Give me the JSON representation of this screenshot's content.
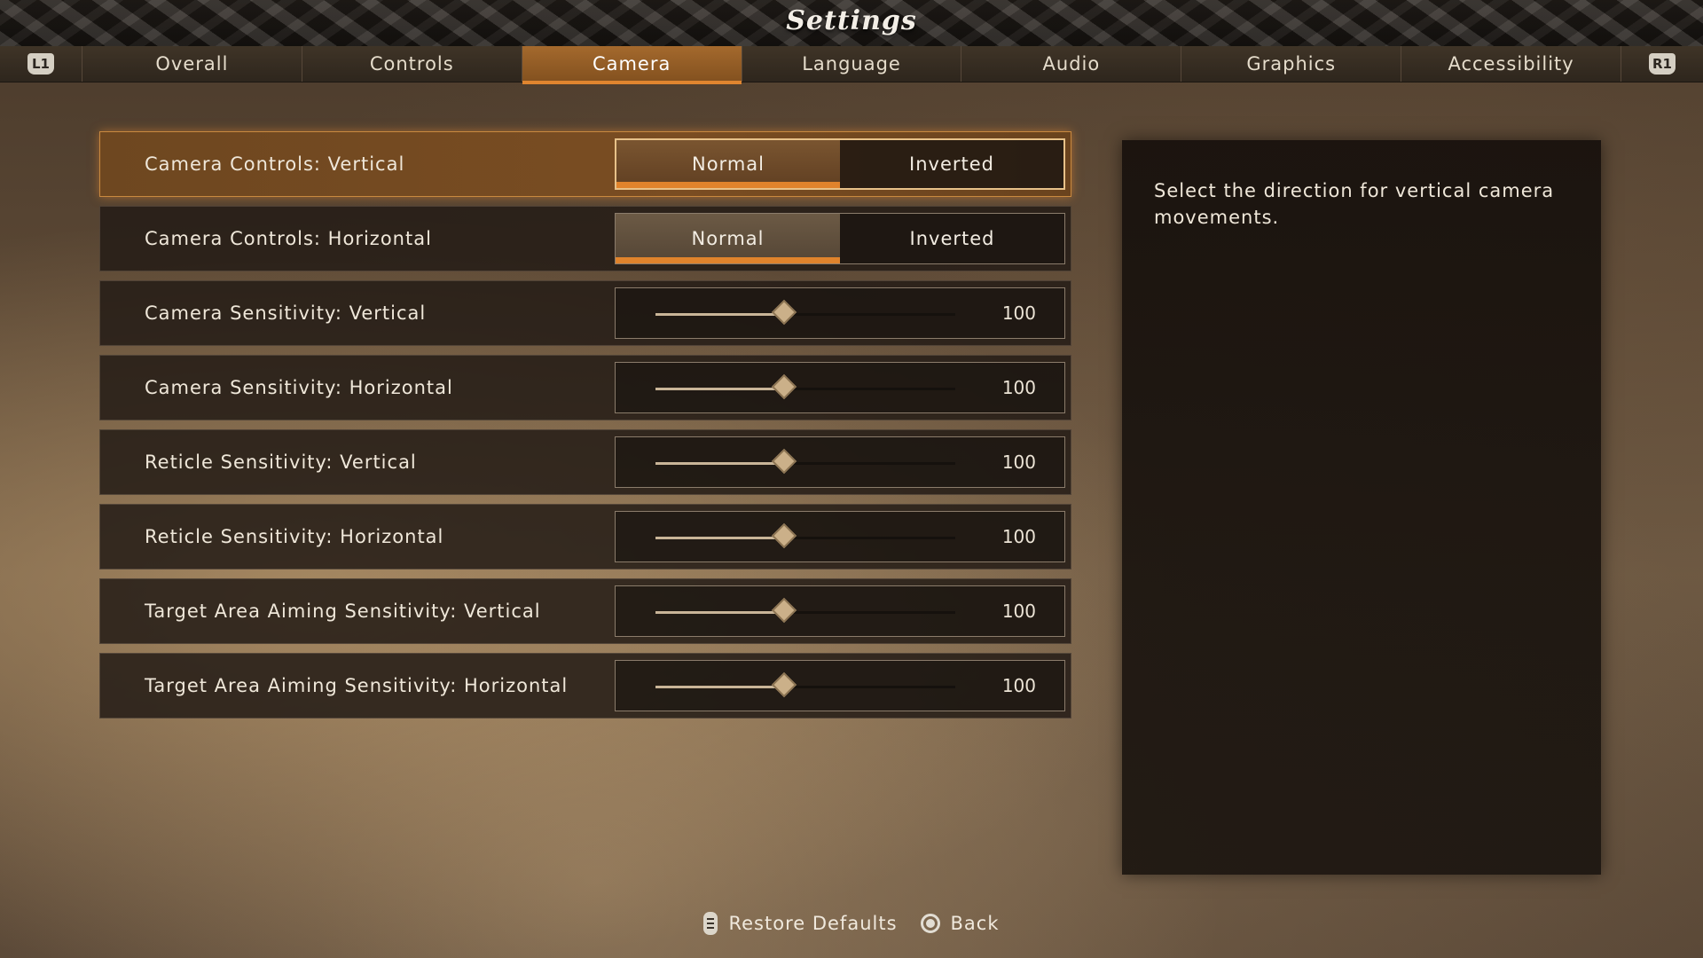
{
  "title": "Settings",
  "nav": {
    "left_button": "L1",
    "right_button": "R1",
    "tabs": [
      {
        "label": "Overall",
        "active": false
      },
      {
        "label": "Controls",
        "active": false
      },
      {
        "label": "Camera",
        "active": true
      },
      {
        "label": "Language",
        "active": false
      },
      {
        "label": "Audio",
        "active": false
      },
      {
        "label": "Graphics",
        "active": false
      },
      {
        "label": "Accessibility",
        "active": false
      }
    ]
  },
  "settings": {
    "camera_vertical": {
      "label": "Camera Controls: Vertical",
      "options": [
        "Normal",
        "Inverted"
      ],
      "selected": "Normal"
    },
    "camera_horizontal": {
      "label": "Camera Controls: Horizontal",
      "options": [
        "Normal",
        "Inverted"
      ],
      "selected": "Normal"
    },
    "sliders": [
      {
        "label": "Camera Sensitivity: Vertical",
        "value": "100",
        "fraction": 0.43
      },
      {
        "label": "Camera Sensitivity: Horizontal",
        "value": "100",
        "fraction": 0.43
      },
      {
        "label": "Reticle Sensitivity: Vertical",
        "value": "100",
        "fraction": 0.43
      },
      {
        "label": "Reticle Sensitivity: Horizontal",
        "value": "100",
        "fraction": 0.43
      },
      {
        "label": "Target Area Aiming Sensitivity: Vertical",
        "value": "100",
        "fraction": 0.43
      },
      {
        "label": "Target Area Aiming Sensitivity: Horizontal",
        "value": "100",
        "fraction": 0.43
      }
    ]
  },
  "description": "Select the direction for vertical camera movements.",
  "footer": {
    "restore_label": "Restore Defaults",
    "back_label": "Back"
  },
  "colors": {
    "accent": "#e0832c",
    "active_tab": "#a4692d"
  }
}
